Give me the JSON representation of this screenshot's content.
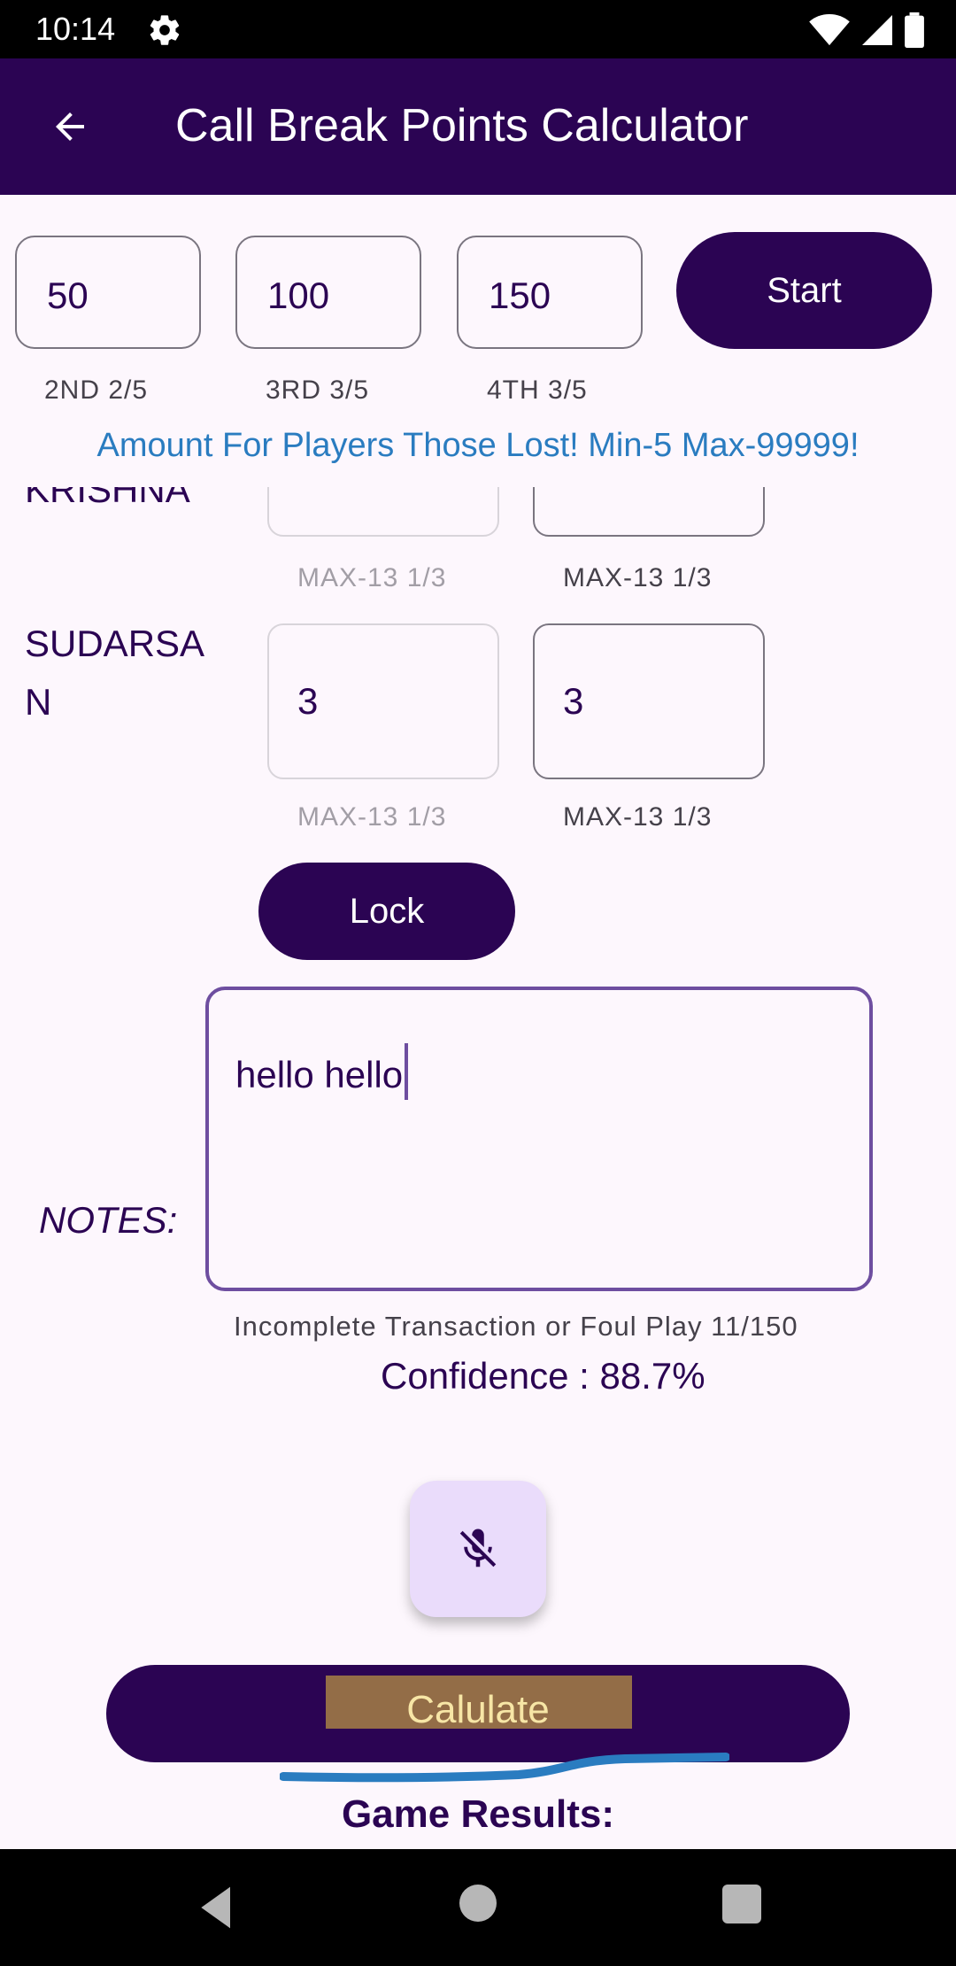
{
  "status_bar": {
    "time": "10:14"
  },
  "app_bar": {
    "title": "Call Break Points Calculator"
  },
  "amounts": [
    {
      "value": "50",
      "help": "2ND   2/5"
    },
    {
      "value": "100",
      "help": "3RD   3/5"
    },
    {
      "value": "150",
      "help": "4TH   3/5"
    }
  ],
  "start_label": "Start",
  "notice": "Amount For Players Those Lost! Min-5 Max-99999!",
  "players": [
    {
      "name": "KRISHNA",
      "bid1": "",
      "bid2": "",
      "help1": "MAX-13  1/3",
      "help2": "MAX-13  1/3"
    },
    {
      "name_line1": "SUDARSA",
      "name_line2": "N",
      "bid1": "3",
      "bid2": "3",
      "help1": "MAX-13  1/3",
      "help2": "MAX-13  1/3"
    }
  ],
  "lock_label": "Lock",
  "notes": {
    "label": "NOTES:",
    "value": "hello hello"
  },
  "status_line": "Incomplete Transaction or Foul Play  11/150",
  "confidence": "Confidence : 88.7%",
  "calculate_label": "Calulate",
  "results_title": "Game Results:",
  "colors": {
    "primary": "#2b0453",
    "notice_blue": "#2a7cc0",
    "mic_bg": "#eadcfb",
    "highlight": "#936d47"
  }
}
